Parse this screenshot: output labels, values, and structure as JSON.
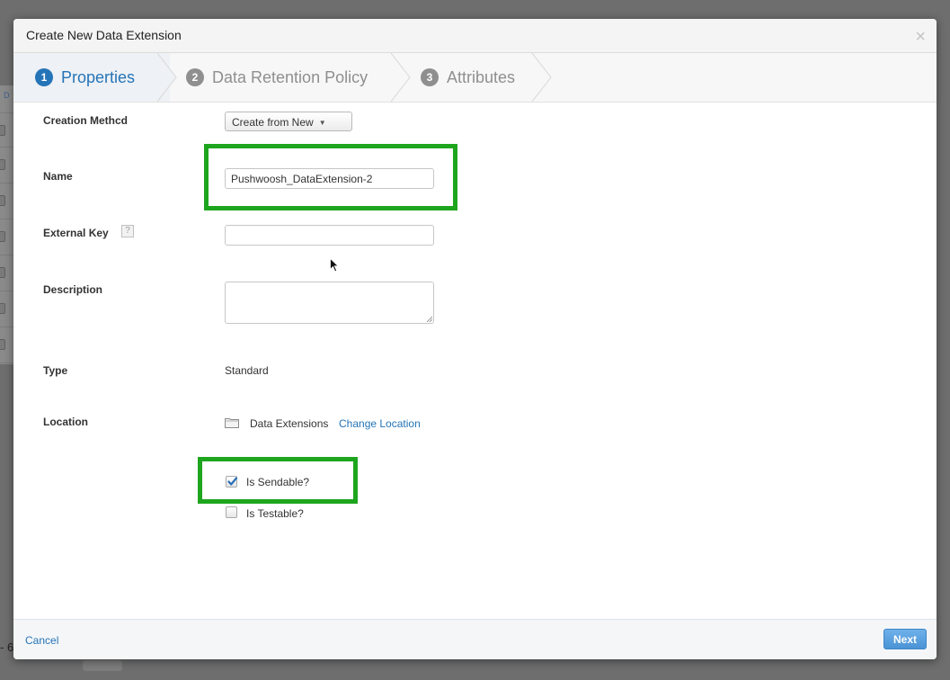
{
  "background": {
    "left_letter": "D",
    "bottom_text": "- 6"
  },
  "dialog": {
    "title": "Create New Data Extension",
    "close_glyph": "×"
  },
  "steps": [
    {
      "number": "1",
      "label": "Properties",
      "active": true
    },
    {
      "number": "2",
      "label": "Data Retention Policy",
      "active": false
    },
    {
      "number": "3",
      "label": "Attributes",
      "active": false
    }
  ],
  "form": {
    "creation_method": {
      "label": "Creation Methcd",
      "value": "Create from New",
      "caret": "▼"
    },
    "name": {
      "label": "Name",
      "value": "Pushwoosh_DataExtension-2"
    },
    "external_key": {
      "label": "External Key",
      "value": "",
      "help": "?"
    },
    "description": {
      "label": "Description",
      "value": ""
    },
    "type": {
      "label": "Type",
      "value": "Standard"
    },
    "location": {
      "label": "Location",
      "value": "Data Extensions",
      "change_link": "Change Location"
    },
    "checkboxes": {
      "sendable": {
        "label": "Is Sendable?",
        "checked": true
      },
      "testable": {
        "label": "Is Testable?",
        "checked": false
      }
    }
  },
  "footer": {
    "cancel_label": "Cancel",
    "next_label": "Next"
  },
  "colors": {
    "accent_blue": "#2574b8",
    "highlight_green": "#1ea51e",
    "overlay_gray": "#6e6e6e"
  },
  "icons": [
    "close-icon",
    "step-number-icon",
    "caret-down-icon",
    "help-icon",
    "folder-icon",
    "check-icon",
    "resize-handle-icon",
    "mouse-cursor-icon"
  ]
}
